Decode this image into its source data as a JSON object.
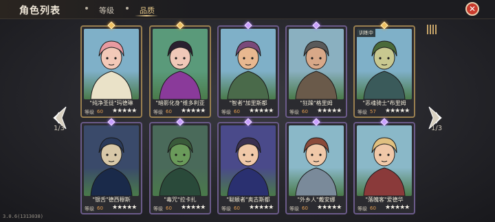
{
  "header": {
    "title": "角色列表",
    "tabs": [
      {
        "label": "等级"
      },
      {
        "label": "品质"
      }
    ],
    "close_icon": "close-icon"
  },
  "pagination": {
    "left": "1/3",
    "right": "1/3"
  },
  "version": "3.0.6(1313038)",
  "level_label": "等级",
  "cards": [
    {
      "name": "\"纯净圣徒\"玛德琳",
      "level": "60",
      "stars": "★★★★★",
      "rarity": "gold",
      "bg": "#7fb0c8",
      "skin": "#f3c9b8",
      "hair": "#e89aa0",
      "cloth": "#eae2c8"
    },
    {
      "name": "\"暗影化身\"维多利亚",
      "level": "60",
      "stars": "★★★★★",
      "rarity": "gold",
      "bg": "#5a9a7a",
      "skin": "#f0c8b8",
      "hair": "#2a2030",
      "cloth": "#8a3a9a"
    },
    {
      "name": "\"智者\"加里斯都",
      "level": "60",
      "stars": "★★★★★",
      "rarity": "purple",
      "bg": "#7fb0c8",
      "skin": "#e8b890",
      "hair": "#7a4a7a",
      "cloth": "#4a6a4a"
    },
    {
      "name": "\"狂躁\"格里姆",
      "level": "60",
      "stars": "★★★★★",
      "rarity": "purple",
      "bg": "#8ab0c0",
      "skin": "#d8a888",
      "hair": "#5a5a5a",
      "cloth": "#6a5a4a"
    },
    {
      "name": "\"恶魂骑士\"布里姆",
      "level": "57",
      "stars": "★★★★★",
      "rarity": "gold",
      "bg": "#7fb0c8",
      "skin": "#c8c890",
      "hair": "#4a6a3a",
      "cloth": "#3a5a5a",
      "status": "训练中"
    },
    {
      "name": "\"银舌\"德西穆斯",
      "level": "60",
      "stars": "★★★★★",
      "rarity": "purple",
      "bg": "#3a4a6a",
      "skin": "#d8c8a8",
      "hair": "#2a3a5a",
      "cloth": "#1a2a4a"
    },
    {
      "name": "\"毒咒\"拉卡扎",
      "level": "60",
      "stars": "★★★★★",
      "rarity": "purple",
      "bg": "#4a6a5a",
      "skin": "#6a9a5a",
      "hair": "#3a5a3a",
      "cloth": "#2a4a3a"
    },
    {
      "name": "\"聪颖者\"奥古斯都",
      "level": "60",
      "stars": "★★★★★",
      "rarity": "purple",
      "bg": "#4a4a8a",
      "skin": "#f0c8a8",
      "hair": "#3a3050",
      "cloth": "#2a3070"
    },
    {
      "name": "\"外乡人\"戴安娜",
      "level": "60",
      "stars": "★★★★★",
      "rarity": "purple",
      "bg": "#8ab8c8",
      "skin": "#f0c8a8",
      "hair": "#8a4a3a",
      "cloth": "#7a8a9a"
    },
    {
      "name": "\"落魄客\"爱德华",
      "level": "60",
      "stars": "★★★★★",
      "rarity": "purple",
      "bg": "#8ab8c8",
      "skin": "#f0c8a8",
      "hair": "#e0c080",
      "cloth": "#8a3a3a"
    }
  ]
}
